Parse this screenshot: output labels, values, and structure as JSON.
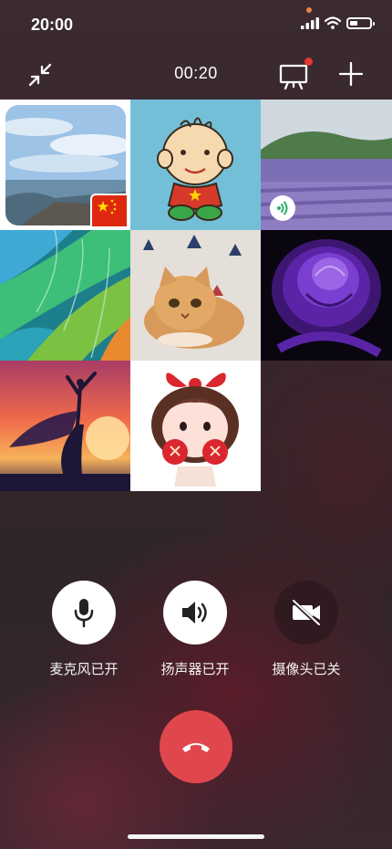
{
  "status_bar": {
    "time": "20:00"
  },
  "call": {
    "timer": "00:20"
  },
  "colors": {
    "accent_dot": "#f0823a",
    "badge_red": "#e53935",
    "hangup_red": "#e0474c",
    "speaking_green": "#2aae67",
    "flag_red": "#de2910",
    "flag_yellow": "#ffde00"
  },
  "participants": [
    {
      "avatar": "coastal-city-photo",
      "badge": "china-flag"
    },
    {
      "avatar": "cartoon-boy"
    },
    {
      "avatar": "lavender-field-photo",
      "badge": "speaking-icon"
    },
    {
      "avatar": "colorful-feathers-photo"
    },
    {
      "avatar": "kitten-photo"
    },
    {
      "avatar": "purple-rose-photo"
    },
    {
      "avatar": "dancer-silhouette-sunset"
    },
    {
      "avatar": "cartoon-girl-red-bow"
    }
  ],
  "controls": {
    "mic_label": "麦克风已开",
    "speaker_label": "扬声器已开",
    "camera_label": "摄像头已关"
  },
  "icons": [
    "minimize-arrows-icon",
    "screen-share-icon",
    "plus-icon",
    "microphone-icon",
    "speaker-icon",
    "camera-off-icon",
    "hang-up-icon",
    "wifi-icon",
    "signal-icon",
    "battery-icon"
  ]
}
